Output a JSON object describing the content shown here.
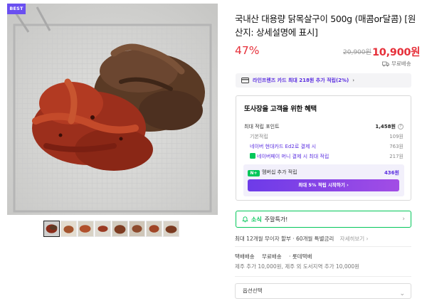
{
  "product": {
    "badge": "BEST",
    "title": "국내산 대용량 닭목살구이 500g (매콤or달콤) [원산지: 상세설명에 표시]",
    "discount": "47%",
    "original_price": "20,900원",
    "price": "10,900원",
    "shipping_label": "무료배송"
  },
  "card_banner": {
    "text": "라인프렌즈 카드 최대 218원 추가 적립(2%)",
    "arrow": "›"
  },
  "benefits": {
    "title": "또사장을 고객을 위한 혜택",
    "max_points_label": "최대 적립 포인트",
    "max_points_value": "1,458원",
    "help": "?",
    "rows": [
      {
        "label": "기본적립",
        "value": "109원"
      },
      {
        "label": "네이버 현대카드 Ed2로 결제 시",
        "value": "763원"
      },
      {
        "label": "네이버페이 머니 결제 시 최대 적립",
        "value": "217원"
      }
    ],
    "membership_badge": "N+",
    "membership_label": "멤버십 추가 적립",
    "membership_value": "436원",
    "membership_button": "최대 5% 적립 시작하기 ›"
  },
  "news": {
    "prefix": "소식",
    "text": "주말특가!",
    "arrow": "›"
  },
  "installment": {
    "text": "최대 12개월 무이자 할부 · 60개월 특별금리",
    "more": "자세히보기 ›"
  },
  "shipping": {
    "type_label": "택배배송",
    "fee": "무료배송",
    "carrier": "· 롯데택배",
    "extra": "제주 추가 10,000원, 제주 외 도서지역 추가 10,000원"
  },
  "option": {
    "placeholder": "옵션선택",
    "arrow": "⌄"
  },
  "colors": {
    "accent_red": "#e6303a",
    "naver_green": "#03c75a",
    "membership_purple": "#5a2de0"
  },
  "icons": [
    "truck-icon",
    "credit-card-icon",
    "question-icon",
    "npay-icon",
    "bell-icon",
    "chevron-right-icon",
    "chevron-down-icon"
  ]
}
